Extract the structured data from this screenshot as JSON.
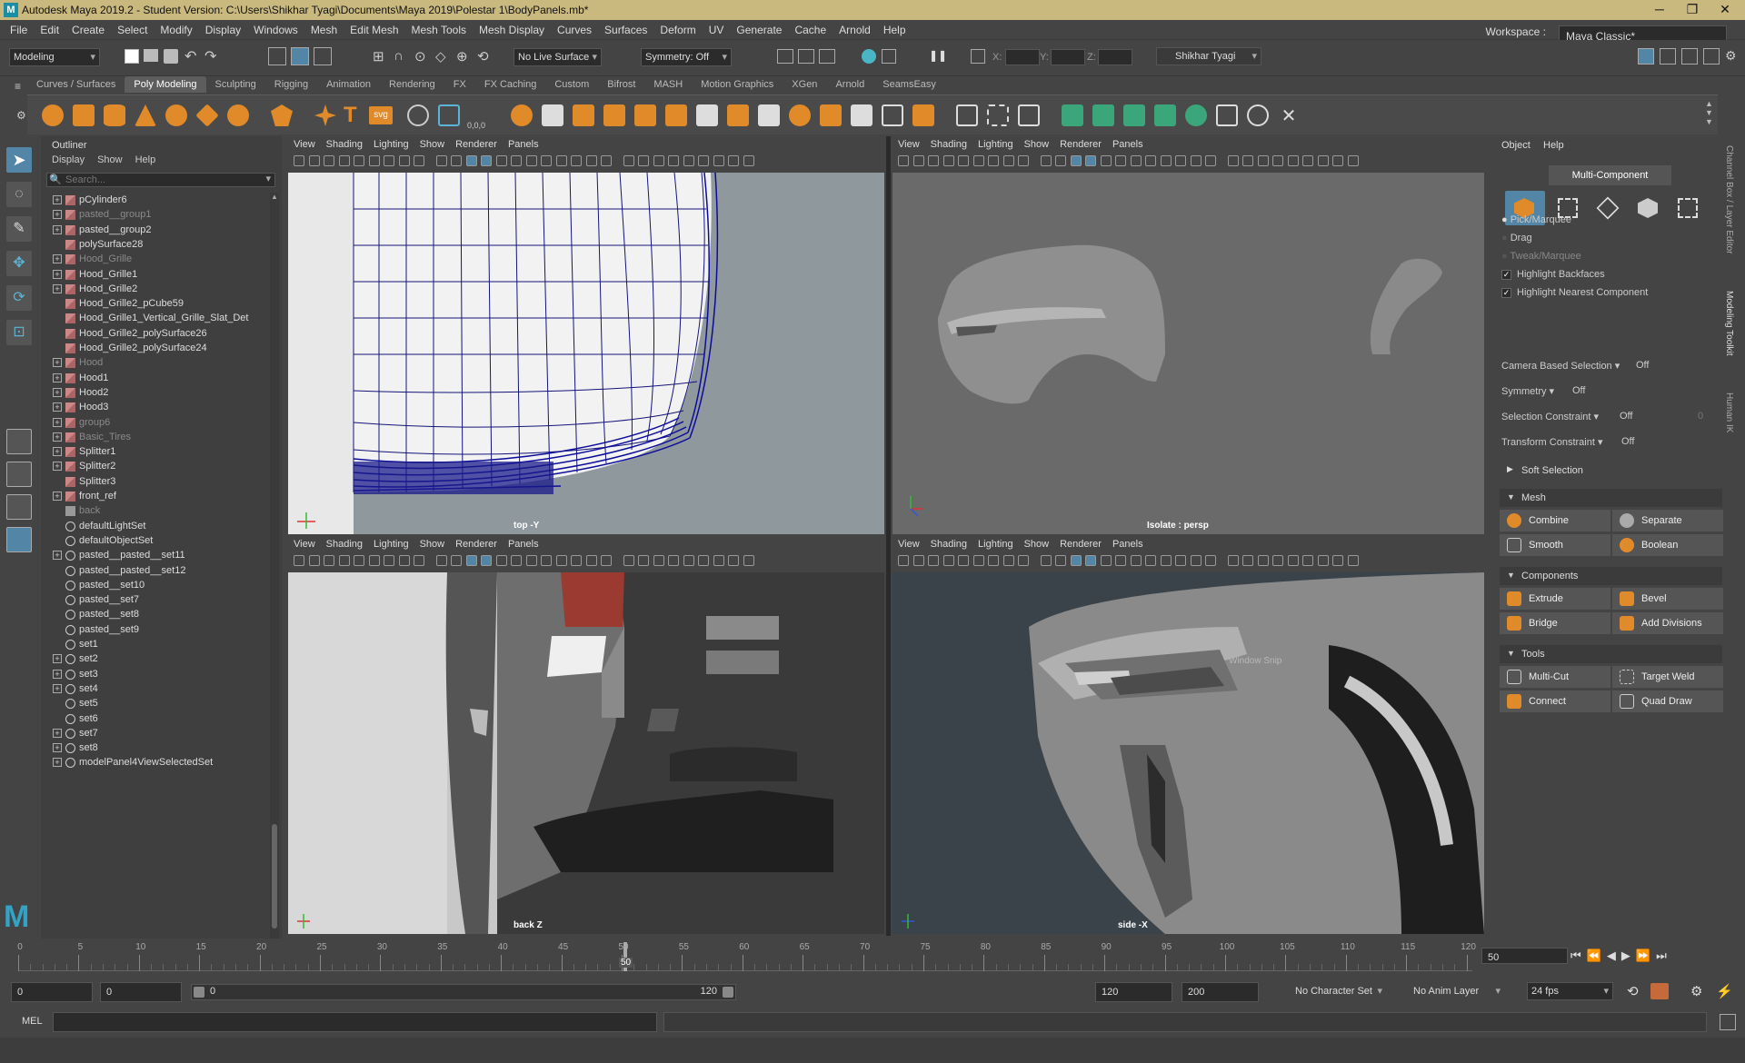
{
  "window": {
    "title": "Autodesk Maya 2019.2 - Student Version: C:\\Users\\Shikhar Tyagi\\Documents\\Maya 2019\\Polestar 1\\BodyPanels.mb*",
    "logo": "M"
  },
  "menubar": {
    "items": [
      "File",
      "Edit",
      "Create",
      "Select",
      "Modify",
      "Display",
      "Windows",
      "Mesh",
      "Edit Mesh",
      "Mesh Tools",
      "Mesh Display",
      "Curves",
      "Surfaces",
      "Deform",
      "UV",
      "Generate",
      "Cache",
      "Arnold",
      "Help"
    ],
    "workspace_label": "Workspace :",
    "workspace_value": "Maya Classic*"
  },
  "statusline": {
    "mode": "Modeling",
    "live_surface": "No Live Surface",
    "symmetry": "Symmetry: Off",
    "x_label": "X:",
    "y_label": "Y:",
    "z_label": "Z:",
    "user": "Shikhar Tyagi"
  },
  "shelf": {
    "tabs": [
      "Curves / Surfaces",
      "Poly Modeling",
      "Sculpting",
      "Rigging",
      "Animation",
      "Rendering",
      "FX",
      "FX Caching",
      "Custom",
      "Bifrost",
      "MASH",
      "Motion Graphics",
      "XGen",
      "Arnold",
      "SeamsEasy"
    ],
    "active_tab": "Poly Modeling",
    "svg_label": "svg",
    "coords_label": "0,0,0"
  },
  "outliner": {
    "title": "Outliner",
    "menu": [
      "Display",
      "Show",
      "Help"
    ],
    "search_placeholder": "Search...",
    "items": [
      {
        "name": "pCylinder6",
        "expand": true,
        "icon": "mesh",
        "dim": false
      },
      {
        "name": "pasted__group1",
        "expand": true,
        "icon": "mesh",
        "dim": true
      },
      {
        "name": "pasted__group2",
        "expand": true,
        "icon": "mesh",
        "dim": false
      },
      {
        "name": "polySurface28",
        "expand": false,
        "icon": "mesh",
        "dim": false
      },
      {
        "name": "Hood_Grille",
        "expand": true,
        "icon": "mesh",
        "dim": true
      },
      {
        "name": "Hood_Grille1",
        "expand": true,
        "icon": "mesh",
        "dim": false
      },
      {
        "name": "Hood_Grille2",
        "expand": true,
        "icon": "mesh",
        "dim": false
      },
      {
        "name": "Hood_Grille2_pCube59",
        "expand": false,
        "icon": "mesh",
        "dim": false
      },
      {
        "name": "Hood_Grille1_Vertical_Grille_Slat_Det",
        "expand": false,
        "icon": "mesh",
        "dim": false
      },
      {
        "name": "Hood_Grille2_polySurface26",
        "expand": false,
        "icon": "mesh",
        "dim": false
      },
      {
        "name": "Hood_Grille2_polySurface24",
        "expand": false,
        "icon": "mesh",
        "dim": false
      },
      {
        "name": "Hood",
        "expand": true,
        "icon": "mesh",
        "dim": true
      },
      {
        "name": "Hood1",
        "expand": true,
        "icon": "mesh",
        "dim": false
      },
      {
        "name": "Hood2",
        "expand": true,
        "icon": "mesh",
        "dim": false
      },
      {
        "name": "Hood3",
        "expand": true,
        "icon": "mesh",
        "dim": false
      },
      {
        "name": "group6",
        "expand": true,
        "icon": "mesh",
        "dim": true
      },
      {
        "name": "Basic_Tires",
        "expand": true,
        "icon": "mesh",
        "dim": true
      },
      {
        "name": "Splitter1",
        "expand": true,
        "icon": "mesh",
        "dim": false
      },
      {
        "name": "Splitter2",
        "expand": true,
        "icon": "mesh",
        "dim": false
      },
      {
        "name": "Splitter3",
        "expand": false,
        "icon": "mesh",
        "dim": false
      },
      {
        "name": "front_ref",
        "expand": true,
        "icon": "mesh",
        "dim": false
      },
      {
        "name": "back",
        "expand": false,
        "icon": "camera",
        "dim": true
      },
      {
        "name": "defaultLightSet",
        "expand": false,
        "icon": "set",
        "dim": false
      },
      {
        "name": "defaultObjectSet",
        "expand": false,
        "icon": "set",
        "dim": false
      },
      {
        "name": "pasted__pasted__set11",
        "expand": true,
        "icon": "set",
        "dim": false
      },
      {
        "name": "pasted__pasted__set12",
        "expand": false,
        "icon": "set",
        "dim": false
      },
      {
        "name": "pasted__set10",
        "expand": false,
        "icon": "set",
        "dim": false
      },
      {
        "name": "pasted__set7",
        "expand": false,
        "icon": "set",
        "dim": false
      },
      {
        "name": "pasted__set8",
        "expand": false,
        "icon": "set",
        "dim": false
      },
      {
        "name": "pasted__set9",
        "expand": false,
        "icon": "set",
        "dim": false
      },
      {
        "name": "set1",
        "expand": false,
        "icon": "set",
        "dim": false
      },
      {
        "name": "set2",
        "expand": true,
        "icon": "set",
        "dim": false
      },
      {
        "name": "set3",
        "expand": true,
        "icon": "set",
        "dim": false
      },
      {
        "name": "set4",
        "expand": true,
        "icon": "set",
        "dim": false
      },
      {
        "name": "set5",
        "expand": false,
        "icon": "set",
        "dim": false
      },
      {
        "name": "set6",
        "expand": false,
        "icon": "set",
        "dim": false
      },
      {
        "name": "set7",
        "expand": true,
        "icon": "set",
        "dim": false
      },
      {
        "name": "set8",
        "expand": true,
        "icon": "set",
        "dim": false
      },
      {
        "name": "modelPanel4ViewSelectedSet",
        "expand": true,
        "icon": "set",
        "dim": false
      }
    ]
  },
  "panel_menu": [
    "View",
    "Shading",
    "Lighting",
    "Show",
    "Renderer",
    "Panels"
  ],
  "viewports": [
    {
      "label": "top -Y"
    },
    {
      "label": "Isolate : persp"
    },
    {
      "label": "back Z"
    },
    {
      "label": "side -X"
    }
  ],
  "modeling_toolkit": {
    "menu": [
      "Object",
      "Help"
    ],
    "multi_component": "Multi-Component",
    "pick_marquee": "Pick/Marquee",
    "drag": "Drag",
    "tweak_marquee": "Tweak/Marquee",
    "highlight_backfaces": "Highlight Backfaces",
    "highlight_nearest": "Highlight Nearest Component",
    "camera_based": "Camera Based Selection",
    "camera_based_value": "Off",
    "symmetry": "Symmetry",
    "symmetry_value": "Off",
    "selection_constraint": "Selection Constraint",
    "selection_constraint_value": "Off",
    "selection_constraint_num": "0",
    "transform_constraint": "Transform Constraint",
    "transform_constraint_value": "Off",
    "soft_selection": "Soft Selection",
    "mesh_section": "Mesh",
    "combine": "Combine",
    "separate": "Separate",
    "smooth": "Smooth",
    "boolean": "Boolean",
    "components_section": "Components",
    "extrude": "Extrude",
    "bevel": "Bevel",
    "bridge": "Bridge",
    "add_divisions": "Add Divisions",
    "tools_section": "Tools",
    "multi_cut": "Multi-Cut",
    "target_weld": "Target Weld",
    "connect": "Connect",
    "quad_draw": "Quad Draw",
    "side_tabs": [
      "Channel Box / Layer Editor",
      "Modeling Toolkit",
      "Human IK"
    ]
  },
  "watermark": "Window Snip",
  "timeline": {
    "ticks": [
      "0",
      "5",
      "10",
      "15",
      "20",
      "25",
      "30",
      "35",
      "40",
      "45",
      "50",
      "55",
      "60",
      "65",
      "70",
      "75",
      "80",
      "85",
      "90",
      "95",
      "100",
      "105",
      "110",
      "115",
      "120"
    ],
    "current_frame": "50",
    "current_field": "50"
  },
  "range": {
    "start": "0",
    "start2": "0",
    "slider_start": "0",
    "slider_end": "120",
    "end": "120",
    "end2": "200",
    "character_set": "No Character Set",
    "anim_layer": "No Anim Layer",
    "fps": "24 fps"
  },
  "cmdline": {
    "label": "MEL"
  }
}
